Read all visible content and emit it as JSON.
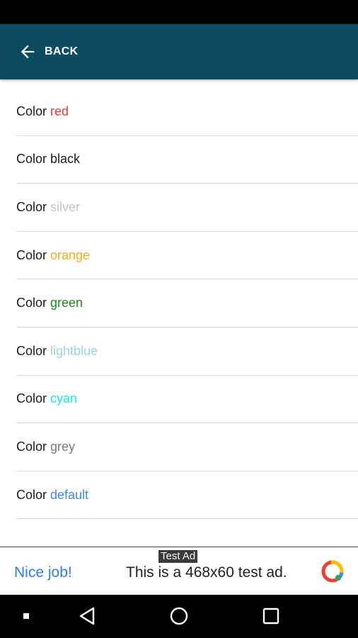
{
  "app_bar": {
    "back_label": "BACK",
    "background": "#0c4c63",
    "back_icon": "arrow-left-icon"
  },
  "colors_list": {
    "prefix": "Color",
    "items": [
      {
        "name": "red",
        "color": "#e53935"
      },
      {
        "name": "black",
        "color": "#1b1b1b"
      },
      {
        "name": "silver",
        "color": "#c4c4c4"
      },
      {
        "name": "orange",
        "color": "#f0ac22"
      },
      {
        "name": "green",
        "color": "#1b8a1b"
      },
      {
        "name": "lightblue",
        "color": "#9fd2e6"
      },
      {
        "name": "cyan",
        "color": "#18e6f0"
      },
      {
        "name": "grey",
        "color": "#7a7a7a"
      },
      {
        "name": "default",
        "color": "#3f86e8"
      }
    ]
  },
  "ad": {
    "tag": "Test Ad",
    "title": "Nice job!",
    "text": "This is a 468x60 test ad.",
    "logo_icon": "ad-choices-logo-icon"
  },
  "nav_bar": {
    "icons": [
      "menu-dot-icon",
      "back-triangle-icon",
      "home-circle-icon",
      "recents-square-icon"
    ]
  }
}
